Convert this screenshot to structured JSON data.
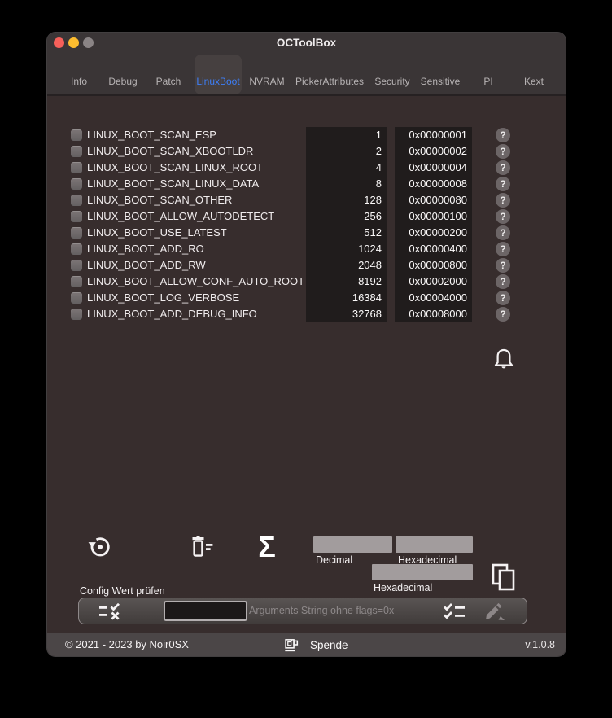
{
  "window": {
    "title": "OCToolBox"
  },
  "tabs": {
    "items": [
      "Info",
      "Debug",
      "Patch",
      "LinuxBoot",
      "NVRAM",
      "PickerAttributes",
      "Security",
      "Sensitive",
      "PI",
      "Kext"
    ],
    "selected": "LinuxBoot"
  },
  "flags": [
    {
      "label": "LINUX_BOOT_SCAN_ESP",
      "dec": "1",
      "hex": "0x00000001",
      "checked": false
    },
    {
      "label": "LINUX_BOOT_SCAN_XBOOTLDR",
      "dec": "2",
      "hex": "0x00000002",
      "checked": false
    },
    {
      "label": "LINUX_BOOT_SCAN_LINUX_ROOT",
      "dec": "4",
      "hex": "0x00000004",
      "checked": false
    },
    {
      "label": "LINUX_BOOT_SCAN_LINUX_DATA",
      "dec": "8",
      "hex": "0x00000008",
      "checked": false
    },
    {
      "label": "LINUX_BOOT_SCAN_OTHER",
      "dec": "128",
      "hex": "0x00000080",
      "checked": false
    },
    {
      "label": "LINUX_BOOT_ALLOW_AUTODETECT",
      "dec": "256",
      "hex": "0x00000100",
      "checked": false
    },
    {
      "label": "LINUX_BOOT_USE_LATEST",
      "dec": "512",
      "hex": "0x00000200",
      "checked": false
    },
    {
      "label": "LINUX_BOOT_ADD_RO",
      "dec": "1024",
      "hex": "0x00000400",
      "checked": false
    },
    {
      "label": "LINUX_BOOT_ADD_RW",
      "dec": "2048",
      "hex": "0x00000800",
      "checked": false
    },
    {
      "label": "LINUX_BOOT_ALLOW_CONF_AUTO_ROOT",
      "dec": "8192",
      "hex": "0x00002000",
      "checked": false
    },
    {
      "label": "LINUX_BOOT_LOG_VERBOSE",
      "dec": "16384",
      "hex": "0x00004000",
      "checked": false
    },
    {
      "label": "LINUX_BOOT_ADD_DEBUG_INFO",
      "dec": "32768",
      "hex": "0x00008000",
      "checked": false
    }
  ],
  "ui": {
    "help_glyph": "?",
    "sigma_glyph": "Σ"
  },
  "converter": {
    "decimal_label": "Decimal",
    "hex_label_1": "Hexadecimal",
    "hex_label_2": "Hexadecimal",
    "decimal_value": "",
    "hex_value_1": "",
    "hex_value_2": ""
  },
  "checker": {
    "title": "Config Wert prüfen",
    "args_value": "",
    "args_hint": "Arguments String ohne flags=0x"
  },
  "footer": {
    "copyright": "© 2021 - 2023 by Noir0SX",
    "donate": "Spende",
    "version": "v.1.0.8"
  },
  "colors": {
    "accent_blue": "#3d7ef7",
    "header_bg": "#3a3536",
    "content_bg": "#372d2d",
    "value_panel_bg": "#201c1c",
    "input_gray": "#a29c9d",
    "footer_bg": "#4b4647",
    "traffic_red": "#f6605a",
    "traffic_yellow": "#fcbc2f",
    "traffic_disabled": "#8a8485"
  }
}
